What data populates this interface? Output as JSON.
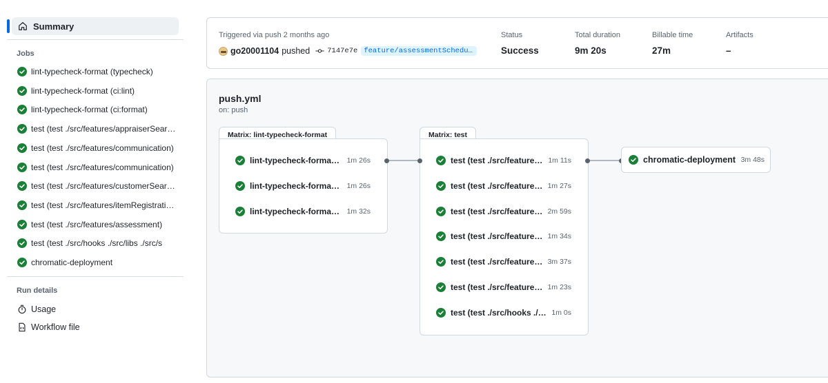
{
  "sidebar": {
    "summary_label": "Summary",
    "jobs_heading": "Jobs",
    "jobs": [
      {
        "label": "lint-typecheck-format (typecheck)"
      },
      {
        "label": "lint-typecheck-format (ci:lint)"
      },
      {
        "label": "lint-typecheck-format (ci:format)"
      },
      {
        "label": "test (test ./src/features/appraiserSearch)"
      },
      {
        "label": "test (test ./src/features/communication)"
      },
      {
        "label": "test (test ./src/features/communication)"
      },
      {
        "label": "test (test ./src/features/customerSearch)"
      },
      {
        "label": "test (test ./src/features/itemRegistration)"
      },
      {
        "label": "test (test ./src/features/assessment)"
      },
      {
        "label": "test (test ./src/hooks ./src/libs ./src/s"
      },
      {
        "label": "chromatic-deployment"
      }
    ],
    "run_details_heading": "Run details",
    "usage_label": "Usage",
    "workflow_file_label": "Workflow file"
  },
  "header": {
    "trigger_text": "Triggered via push 2 months ago",
    "actor": "go20001104",
    "action": "pushed",
    "commit_sha": "7147e7e",
    "branch": "feature/assessmentScheduling",
    "status_label": "Status",
    "status_value": "Success",
    "duration_label": "Total duration",
    "duration_value": "9m 20s",
    "billable_label": "Billable time",
    "billable_value": "27m",
    "artifacts_label": "Artifacts",
    "artifacts_value": "–"
  },
  "graph": {
    "workflow_name": "push.yml",
    "trigger": "on: push",
    "matrix1": {
      "title": "Matrix: lint-typecheck-format",
      "jobs": [
        {
          "name": "lint-typecheck-format (typecheck)",
          "duration": "1m 26s"
        },
        {
          "name": "lint-typecheck-format (ci:lint)",
          "duration": "1m 26s"
        },
        {
          "name": "lint-typecheck-format (ci:format)",
          "duration": "1m 32s"
        }
      ]
    },
    "matrix2": {
      "title": "Matrix: test",
      "jobs": [
        {
          "name": "test (test ./src/features/appraiserSearch)",
          "duration": "1m 11s"
        },
        {
          "name": "test (test ./src/features/communication)",
          "duration": "1m 27s"
        },
        {
          "name": "test (test ./src/features/communication)",
          "duration": "2m 59s"
        },
        {
          "name": "test (test ./src/features/customerSearch)",
          "duration": "1m 34s"
        },
        {
          "name": "test (test ./src/features/itemRegistration)",
          "duration": "3m 37s"
        },
        {
          "name": "test (test ./src/features/assessment)",
          "duration": "1m 23s"
        },
        {
          "name": "test (test ./src/hooks ./src/libs ./src/s",
          "duration": "1m 0s"
        }
      ]
    },
    "deploy": {
      "name": "chromatic-deployment",
      "duration": "3m 48s"
    }
  },
  "colors": {
    "success": "#1a7f37",
    "accent": "#0969da"
  }
}
